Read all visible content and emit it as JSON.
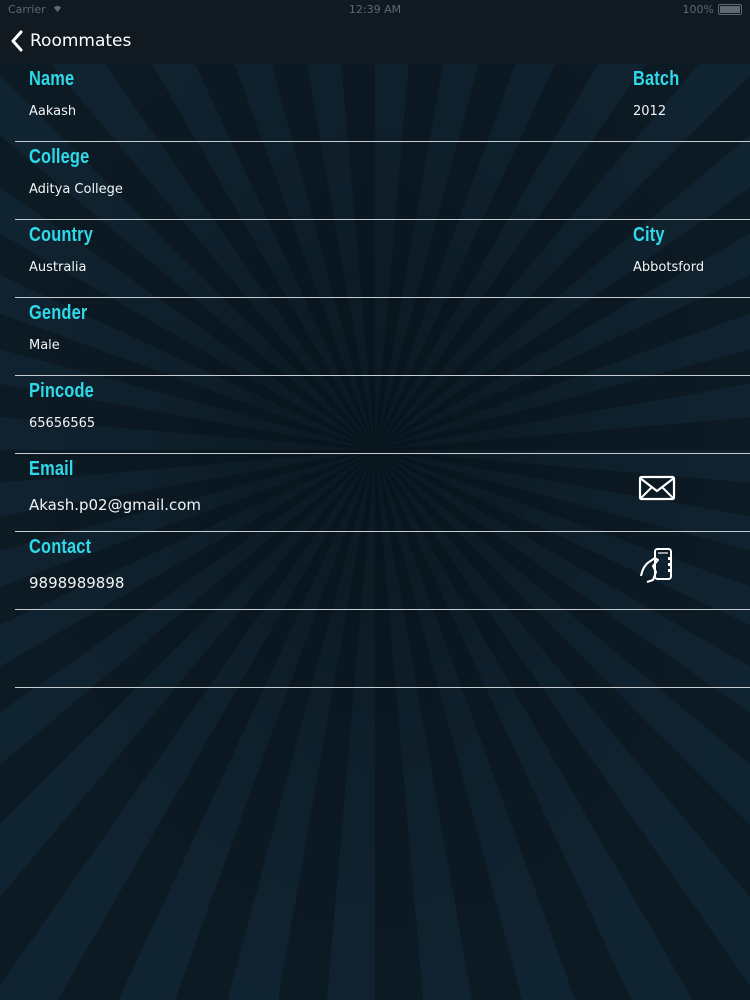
{
  "statusbar": {
    "carrier": "Carrier",
    "time": "12:39 AM",
    "battery": "100%"
  },
  "navbar": {
    "back_label": "Roommates"
  },
  "fields": {
    "name": {
      "label": "Name",
      "value": "Aakash"
    },
    "batch": {
      "label": "Batch",
      "value": "2012"
    },
    "college": {
      "label": "College",
      "value": "Aditya College"
    },
    "country": {
      "label": "Country",
      "value": "Australia"
    },
    "city": {
      "label": "City",
      "value": "Abbotsford"
    },
    "gender": {
      "label": "Gender",
      "value": "Male"
    },
    "pincode": {
      "label": "Pincode",
      "value": "65656565"
    },
    "email": {
      "label": "Email",
      "value": "Akash.p02@gmail.com"
    },
    "contact": {
      "label": "Contact",
      "value": "9898989898"
    }
  },
  "icons": {
    "back": "chevron-left-icon",
    "email": "mail-icon",
    "phone": "phone-in-hand-icon"
  },
  "colors": {
    "label": "#2fd9e8",
    "value": "#f2f4f5",
    "divider": "#c6ccd0",
    "bar": "#101a20"
  }
}
